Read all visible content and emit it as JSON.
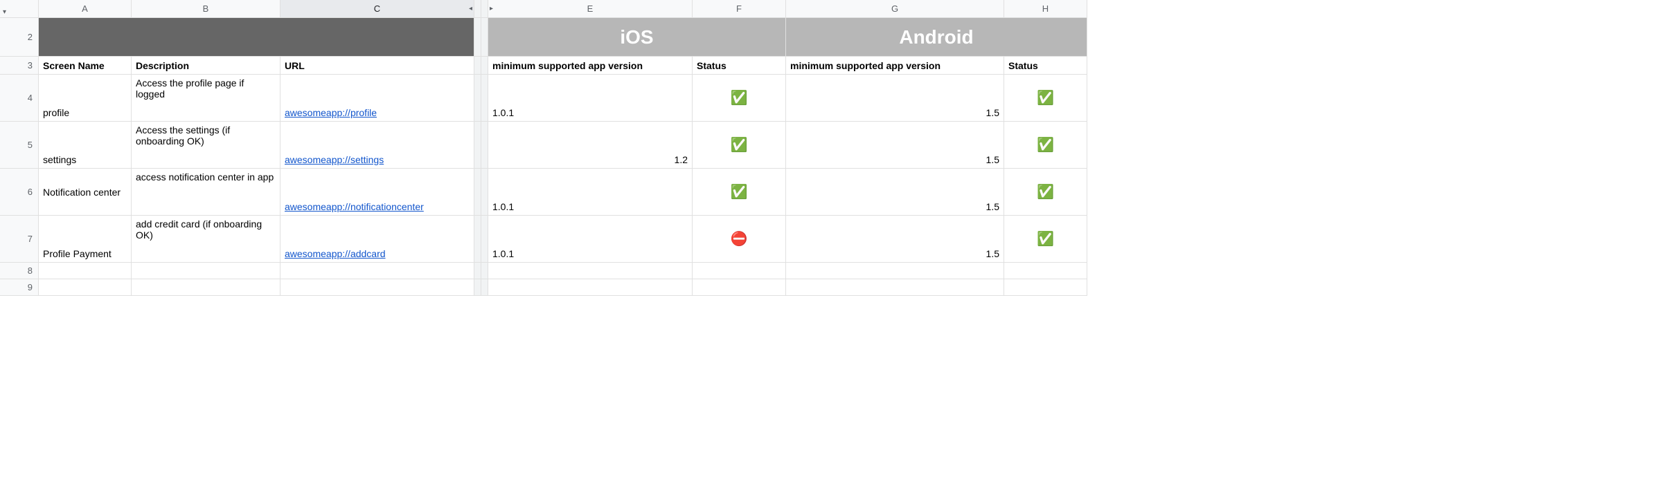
{
  "columns": {
    "A": "A",
    "B": "B",
    "C": "C",
    "E": "E",
    "F": "F",
    "G": "G",
    "H": "H"
  },
  "row_numbers": [
    "2",
    "3",
    "4",
    "5",
    "6",
    "7",
    "8",
    "9"
  ],
  "platform_titles": {
    "ios": "iOS",
    "android": "Android"
  },
  "headers": {
    "screen_name": "Screen Name",
    "description": "Description",
    "url": "URL",
    "min_ver": "minimum supported app version",
    "status": "Status"
  },
  "rows": [
    {
      "screen": "profile",
      "desc": "Access the profile page if logged",
      "url": "awesomeapp://profile",
      "ios_ver": "1.0.1",
      "ios_status": "✅",
      "and_ver": "1.5",
      "and_status": "✅"
    },
    {
      "screen": "settings",
      "desc": "Access the settings (if onboarding OK)",
      "url": "awesomeapp://settings",
      "ios_ver": "1.2",
      "ios_status": "✅",
      "and_ver": "1.5",
      "and_status": "✅"
    },
    {
      "screen": "Notification center",
      "desc": "access notification center in app",
      "url": "awesomeapp://notificationcenter",
      "ios_ver": "1.0.1",
      "ios_status": "✅",
      "and_ver": "1.5",
      "and_status": "✅"
    },
    {
      "screen": "Profile Payment",
      "desc": "add credit card (if onboarding OK)",
      "url": "awesomeapp://addcard",
      "ios_ver": "1.0.1",
      "ios_status": "⛔",
      "and_ver": "1.5",
      "and_status": "✅"
    }
  ],
  "icons": {
    "dropdown": "▾",
    "collapse_left": "◂",
    "collapse_right": "▸"
  }
}
